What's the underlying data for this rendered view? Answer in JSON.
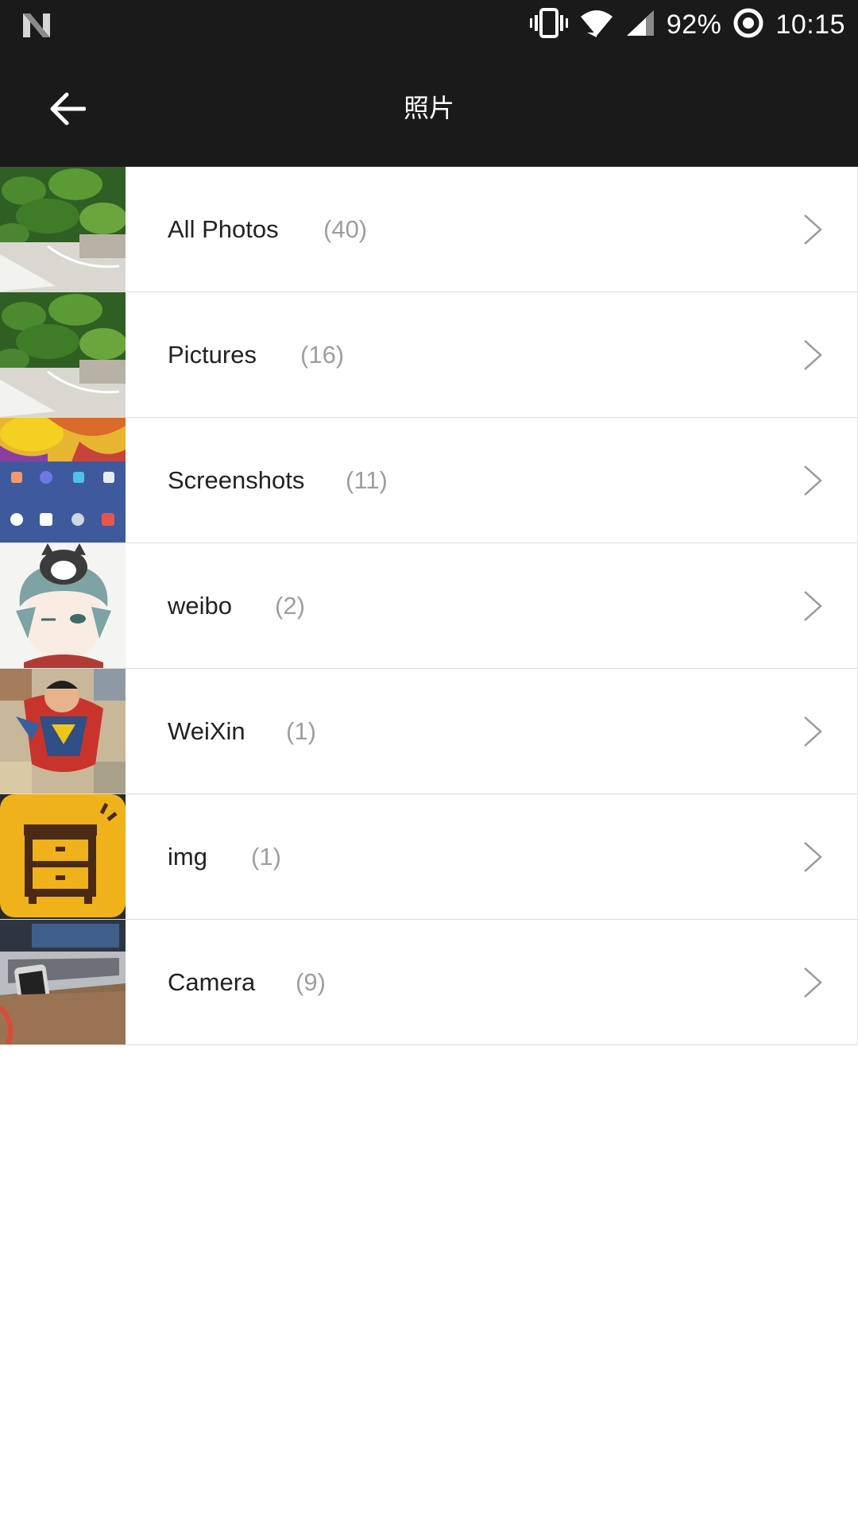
{
  "status_bar": {
    "battery": "92%",
    "time": "10:15",
    "icons": [
      "notification-n-icon",
      "vibrate-icon",
      "wifi-icon",
      "signal-icon",
      "data-saver-icon"
    ]
  },
  "app_bar": {
    "title": "照片",
    "back_icon": "arrow-left-icon"
  },
  "albums": [
    {
      "name": "All Photos",
      "count": "(40)",
      "thumbnail": "plants-photo"
    },
    {
      "name": "Pictures",
      "count": "(16)",
      "thumbnail": "plants-photo"
    },
    {
      "name": "Screenshots",
      "count": "(11)",
      "thumbnail": "homescreen-screenshot"
    },
    {
      "name": "weibo",
      "count": "(2)",
      "thumbnail": "anime-portrait"
    },
    {
      "name": "WeiXin",
      "count": "(1)",
      "thumbnail": "comic-hero"
    },
    {
      "name": "img",
      "count": "(1)",
      "thumbnail": "cabinet-app-icon"
    },
    {
      "name": "Camera",
      "count": "(9)",
      "thumbnail": "laptop-phone-photo"
    }
  ],
  "colors": {
    "bar_background": "#1a1a1a",
    "count_gray": "#9e9e9e",
    "divider": "#dcdcdc"
  }
}
